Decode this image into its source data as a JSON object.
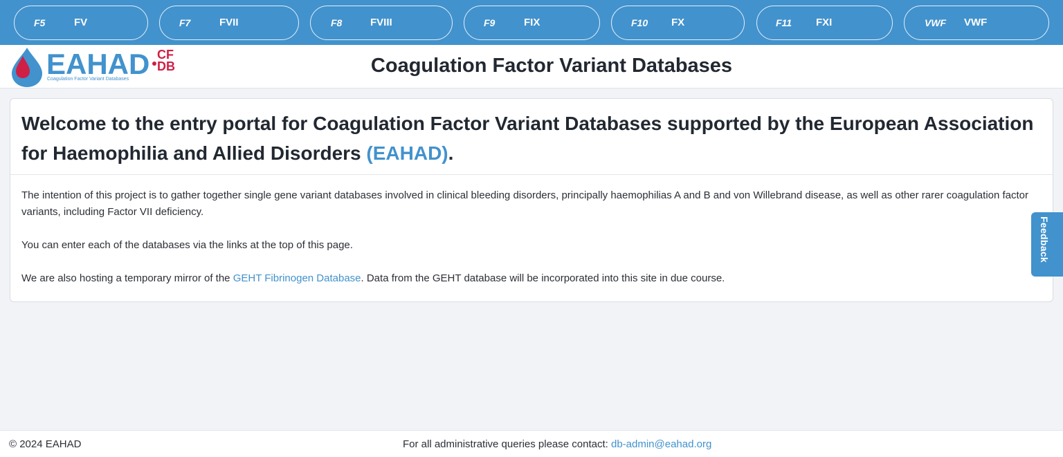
{
  "nav": {
    "items": [
      {
        "code": "F5",
        "name": "FV"
      },
      {
        "code": "F7",
        "name": "FVII"
      },
      {
        "code": "F8",
        "name": "FVIII"
      },
      {
        "code": "F9",
        "name": "FIX"
      },
      {
        "code": "F10",
        "name": "FX"
      },
      {
        "code": "F11",
        "name": "FXI"
      },
      {
        "code": "VWF",
        "name": "VWF"
      }
    ]
  },
  "header": {
    "logo_word": "EAHAD",
    "logo_cf": "CF",
    "logo_db": "DB",
    "logo_tagline": "Coagulation Factor Variant Databases",
    "title": "Coagulation Factor Variant Databases"
  },
  "welcome": {
    "heading_prefix": "Welcome to the entry portal for Coagulation Factor Variant Databases supported by the European Association for Haemophilia and Allied Disorders ",
    "heading_accent": "(EAHAD)",
    "heading_suffix": ".",
    "paragraph1": "The intention of this project is to gather together single gene variant databases involved in clinical bleeding disorders, principally haemophilias A and B and von Willebrand disease, as well as other rarer coagulation factor variants, including Factor VII deficiency.",
    "paragraph2": "You can enter each of the databases via the links at the top of this page.",
    "paragraph3_prefix": "We are also hosting a temporary mirror of the ",
    "paragraph3_link": "GEHT Fibrinogen Database",
    "paragraph3_suffix": ". Data from the GEHT database will be incorporated into this site in due course."
  },
  "feedback": {
    "label": "Feedback"
  },
  "footer": {
    "copyright": "© 2024 EAHAD",
    "contact_prefix": "For all administrative queries please contact: ",
    "contact_email": "db-admin@eahad.org"
  },
  "colors": {
    "brand_blue": "#4292cd",
    "brand_red": "#cf1f45",
    "page_background": "#f1f3f7"
  }
}
